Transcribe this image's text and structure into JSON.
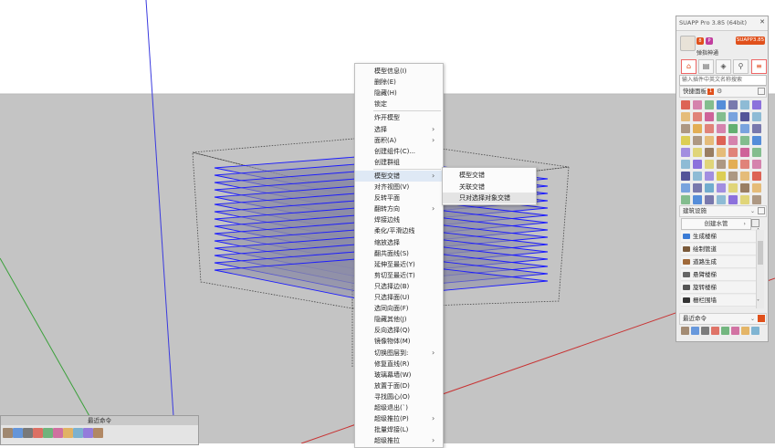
{
  "context_menu": {
    "items": [
      {
        "label": "模型信息(I)",
        "submenu": false
      },
      {
        "label": "删除(E)",
        "submenu": false
      },
      {
        "label": "隐藏(H)",
        "submenu": false
      },
      {
        "label": "锁定",
        "submenu": false
      },
      {
        "label": "炸开模型",
        "submenu": false
      },
      {
        "label": "选择",
        "submenu": true
      },
      {
        "label": "面积(A)",
        "submenu": true
      },
      {
        "label": "创建组件(C)...",
        "submenu": false
      },
      {
        "label": "创建群组",
        "submenu": false
      },
      {
        "label": "模型交错",
        "submenu": true
      },
      {
        "label": "对齐视图(V)",
        "submenu": false
      },
      {
        "label": "反转平面",
        "submenu": false
      },
      {
        "label": "翻转方向",
        "submenu": true
      },
      {
        "label": "焊接边线",
        "submenu": false
      },
      {
        "label": "柔化/平滑边线",
        "submenu": false
      },
      {
        "label": "缩放选择",
        "submenu": false
      },
      {
        "label": "翻共面线(S)",
        "submenu": false
      },
      {
        "label": "延伸至最近(Y)",
        "submenu": false
      },
      {
        "label": "剪切至最近(T)",
        "submenu": false
      },
      {
        "label": "只选择边(B)",
        "submenu": false
      },
      {
        "label": "只选择面(U)",
        "submenu": false
      },
      {
        "label": "选同向面(F)",
        "submenu": false
      },
      {
        "label": "隐藏其他(J)",
        "submenu": false
      },
      {
        "label": "反向选择(Q)",
        "submenu": false
      },
      {
        "label": "镜像物体(M)",
        "submenu": false
      },
      {
        "label": "切换图层到:",
        "submenu": true
      },
      {
        "label": "修复直线(R)",
        "submenu": false
      },
      {
        "label": "玻璃幕墙(W)",
        "submenu": false
      },
      {
        "label": "放置于面(D)",
        "submenu": false
      },
      {
        "label": "寻找圆心(O)",
        "submenu": false
      },
      {
        "label": "超级退出(`)",
        "submenu": false
      },
      {
        "label": "超级推拉(P)",
        "submenu": true
      },
      {
        "label": "批量焊接(L)",
        "submenu": false
      },
      {
        "label": "超级推拉",
        "submenu": true
      }
    ],
    "submenu_items": [
      {
        "label": "模型交错"
      },
      {
        "label": "关联交错"
      },
      {
        "label": "只对选择对象交错"
      }
    ]
  },
  "suapp": {
    "title": "SUAPP Pro 3.85 (64bit)",
    "close": "✕",
    "user_name": "弹指神通",
    "badge1": "8",
    "badge2": "P",
    "version_badge": "SUAPP3.85",
    "search_placeholder": "输入插件中英文名称搜索",
    "section_quick": "快捷面板",
    "section_quick_num": "1",
    "section_building": "建筑设施",
    "dropdown_value": "创建水管",
    "section_recent": "最近命令",
    "list_items": [
      {
        "label": "生成楼梯"
      },
      {
        "label": "绘制管道"
      },
      {
        "label": "道路生成"
      },
      {
        "label": "悬臂楼梯"
      },
      {
        "label": "旋转楼梯"
      },
      {
        "label": "栅栏围墙"
      }
    ],
    "accent": "#e0501b"
  },
  "recent_panel": {
    "title": "最近命令"
  }
}
